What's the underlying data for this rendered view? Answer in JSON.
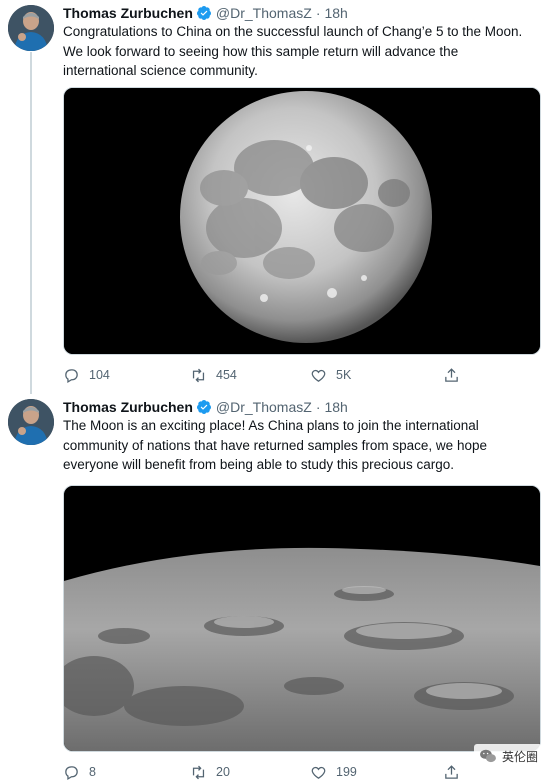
{
  "tweets": [
    {
      "author": {
        "name": "Thomas Zurbuchen",
        "handle": "@Dr_ThomasZ",
        "verified": true
      },
      "time": "18h",
      "text_lines": [
        "Congratulations to China on the successful launch of Chang’e 5 to the Moon.",
        "We look forward to seeing how this sample return will advance the",
        "international science community."
      ],
      "media": "full-moon-photo",
      "stats": {
        "replies": "104",
        "retweets": "454",
        "likes": "5K"
      }
    },
    {
      "author": {
        "name": "Thomas Zurbuchen",
        "handle": "@Dr_ThomasZ",
        "verified": true
      },
      "time": "18h",
      "text_lines": [
        "The Moon is an exciting place! As China plans to join the international",
        "community of nations that have returned samples from space, we hope",
        "everyone will benefit from being able to study this precious cargo."
      ],
      "media": "lunar-surface-photo",
      "stats": {
        "replies": "8",
        "retweets": "20",
        "likes": "199"
      }
    }
  ],
  "separator_dot": "·",
  "watermark": {
    "text": "英伦圈"
  },
  "colors": {
    "verified_blue": "#1d9bf0",
    "secondary_text": "#536471",
    "thread_line": "#cfd9de"
  },
  "icons": {
    "reply": "reply-icon",
    "retweet": "retweet-icon",
    "like": "heart-icon",
    "share": "share-icon",
    "verified": "verified-badge-icon"
  }
}
